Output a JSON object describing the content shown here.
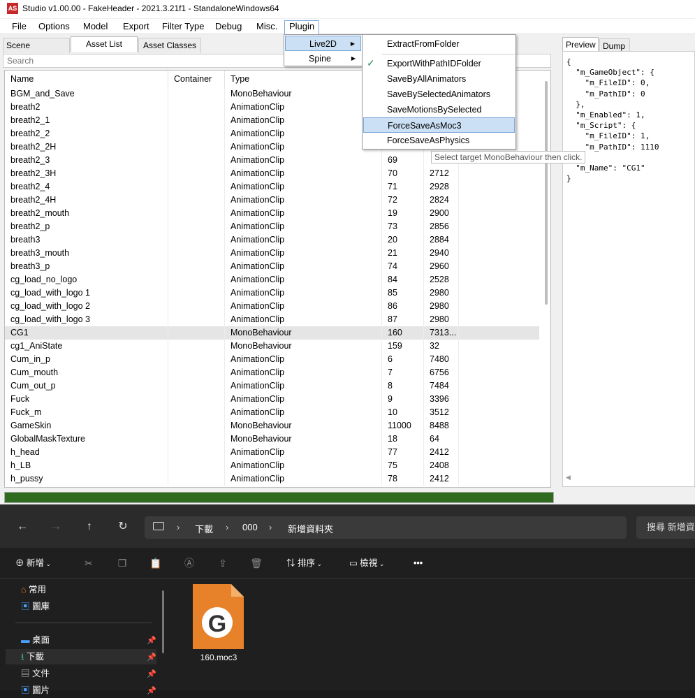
{
  "window": {
    "title": "Studio v1.00.00 - FakeHeader - 2021.3.21f1 - StandaloneWindows64",
    "logo": "AS"
  },
  "menubar": [
    "File",
    "Options",
    "Model",
    "Export",
    "Filter Type",
    "Debug",
    "Misc.",
    "Plugin"
  ],
  "tabs": {
    "scene_hierarchy": "Scene Hierarchy",
    "asset_list": "Asset List",
    "asset_classes": "Asset Classes"
  },
  "search_placeholder": "Search",
  "columns": {
    "name": "Name",
    "container": "Container",
    "type": "Type"
  },
  "rows": [
    {
      "name": "BGM_and_Save",
      "type": "MonoBehaviour",
      "pathid": "",
      "size": ""
    },
    {
      "name": "breath2",
      "type": "AnimationClip",
      "pathid": "",
      "size": ""
    },
    {
      "name": "breath2_1",
      "type": "AnimationClip",
      "pathid": "",
      "size": ""
    },
    {
      "name": "breath2_2",
      "type": "AnimationClip",
      "pathid": "",
      "size": ""
    },
    {
      "name": "breath2_2H",
      "type": "AnimationClip",
      "pathid": "",
      "size": ""
    },
    {
      "name": "breath2_3",
      "type": "AnimationClip",
      "pathid": "69",
      "size": ""
    },
    {
      "name": "breath2_3H",
      "type": "AnimationClip",
      "pathid": "70",
      "size": "2712"
    },
    {
      "name": "breath2_4",
      "type": "AnimationClip",
      "pathid": "71",
      "size": "2928"
    },
    {
      "name": "breath2_4H",
      "type": "AnimationClip",
      "pathid": "72",
      "size": "2824"
    },
    {
      "name": "breath2_mouth",
      "type": "AnimationClip",
      "pathid": "19",
      "size": "2900"
    },
    {
      "name": "breath2_p",
      "type": "AnimationClip",
      "pathid": "73",
      "size": "2856"
    },
    {
      "name": "breath3",
      "type": "AnimationClip",
      "pathid": "20",
      "size": "2884"
    },
    {
      "name": "breath3_mouth",
      "type": "AnimationClip",
      "pathid": "21",
      "size": "2940"
    },
    {
      "name": "breath3_p",
      "type": "AnimationClip",
      "pathid": "74",
      "size": "2960"
    },
    {
      "name": "cg_load_no_logo",
      "type": "AnimationClip",
      "pathid": "84",
      "size": "2528"
    },
    {
      "name": "cg_load_with_logo 1",
      "type": "AnimationClip",
      "pathid": "85",
      "size": "2980"
    },
    {
      "name": "cg_load_with_logo 2",
      "type": "AnimationClip",
      "pathid": "86",
      "size": "2980"
    },
    {
      "name": "cg_load_with_logo 3",
      "type": "AnimationClip",
      "pathid": "87",
      "size": "2980"
    },
    {
      "name": "CG1",
      "type": "MonoBehaviour",
      "pathid": "160",
      "size": "7313...",
      "selected": true
    },
    {
      "name": "cg1_AniState",
      "type": "MonoBehaviour",
      "pathid": "159",
      "size": "32"
    },
    {
      "name": "Cum_in_p",
      "type": "AnimationClip",
      "pathid": "6",
      "size": "7480"
    },
    {
      "name": "Cum_mouth",
      "type": "AnimationClip",
      "pathid": "7",
      "size": "6756"
    },
    {
      "name": "Cum_out_p",
      "type": "AnimationClip",
      "pathid": "8",
      "size": "7484"
    },
    {
      "name": "Fuck",
      "type": "AnimationClip",
      "pathid": "9",
      "size": "3396"
    },
    {
      "name": "Fuck_m",
      "type": "AnimationClip",
      "pathid": "10",
      "size": "3512"
    },
    {
      "name": "GameSkin",
      "type": "MonoBehaviour",
      "pathid": "11000",
      "size": "8488"
    },
    {
      "name": "GlobalMaskTexture",
      "type": "MonoBehaviour",
      "pathid": "18",
      "size": "64"
    },
    {
      "name": "h_head",
      "type": "AnimationClip",
      "pathid": "77",
      "size": "2412"
    },
    {
      "name": "h_LB",
      "type": "AnimationClip",
      "pathid": "75",
      "size": "2408"
    },
    {
      "name": "h_pussy",
      "type": "AnimationClip",
      "pathid": "78",
      "size": "2412"
    }
  ],
  "preview_tabs": {
    "preview": "Preview",
    "dump": "Dump"
  },
  "preview_json": "{\n  \"m_GameObject\": {\n    \"m_FileID\": 0,\n    \"m_PathID\": 0\n  },\n  \"m_Enabled\": 1,\n  \"m_Script\": {\n    \"m_FileID\": 1,\n    \"m_PathID\": 1110\n  },\n  \"m_Name\": \"CG1\"\n}",
  "plugin_menu": {
    "live2d": "Live2D",
    "spine": "Spine"
  },
  "live2d_menu": [
    "ExtractFromFolder",
    "ExportWithPathIDFolder",
    "SaveByAllAnimators",
    "SaveBySelectedAnimators",
    "SaveMotionsBySelected",
    "ForceSaveAsMoc3",
    "ForceSaveAsPhysics"
  ],
  "tooltip": "Select target MonoBehaviour then click.",
  "explorer": {
    "breadcrumb": [
      "下載",
      "000",
      "新增資料夾"
    ],
    "search_placeholder": "搜尋 新增資",
    "toolbar": {
      "new": "新增",
      "sort": "排序",
      "view": "檢視",
      "more": "•••"
    },
    "nav": [
      {
        "label": "常用",
        "pinned": false
      },
      {
        "label": "圖庫",
        "pinned": false
      },
      {
        "label": "桌面",
        "pinned": true
      },
      {
        "label": "下載",
        "pinned": true
      },
      {
        "label": "文件",
        "pinned": true
      },
      {
        "label": "圖片",
        "pinned": true
      }
    ],
    "file": {
      "name": "160.moc3",
      "letter": "G"
    }
  },
  "colors": {
    "progress": "#2e6b1e",
    "highlight": "#cce0f5",
    "file_icon": "#e8822a"
  }
}
